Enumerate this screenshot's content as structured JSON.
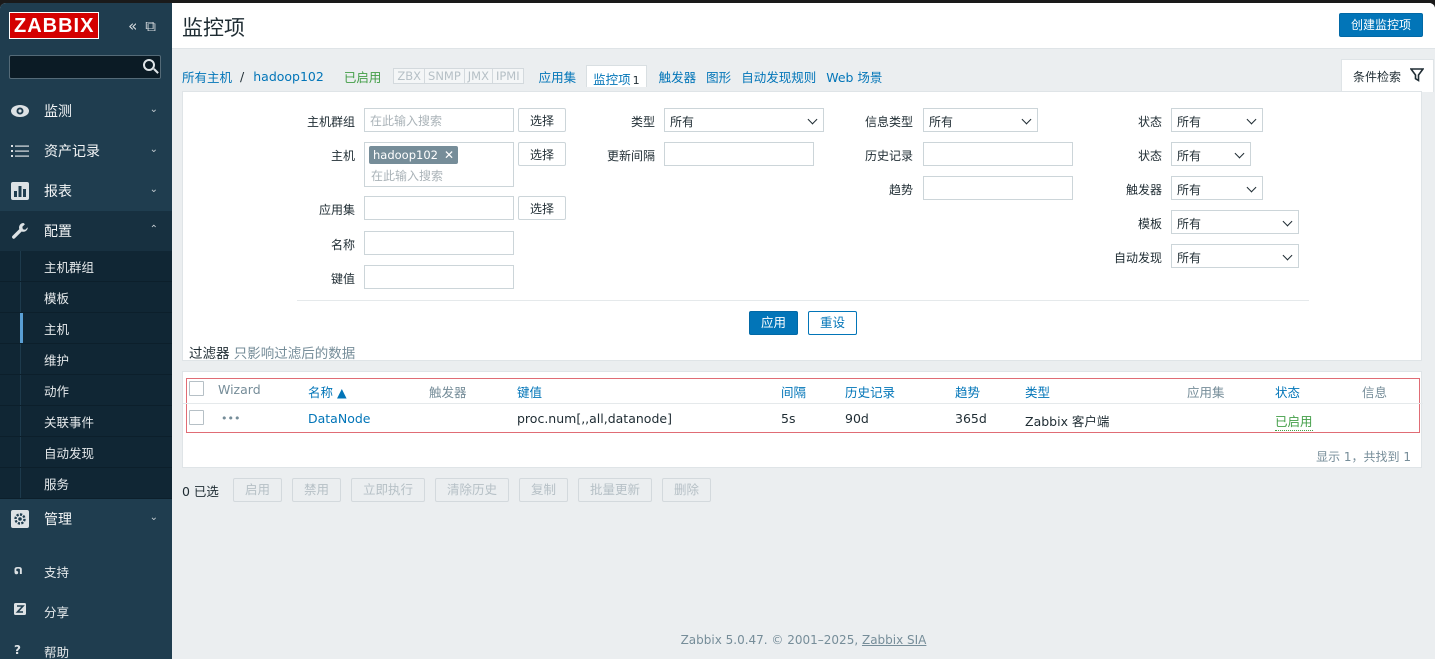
{
  "app": {
    "logo": "ZABBIX"
  },
  "sidebar": {
    "menu": [
      {
        "label": "监测",
        "icon": "eye-icon"
      },
      {
        "label": "资产记录",
        "icon": "list-icon"
      },
      {
        "label": "报表",
        "icon": "bar-chart-icon"
      },
      {
        "label": "配置",
        "icon": "wrench-icon"
      }
    ],
    "submenu": [
      "主机群组",
      "模板",
      "主机",
      "维护",
      "动作",
      "关联事件",
      "自动发现",
      "服务"
    ],
    "admin": {
      "label": "管理",
      "icon": "gear-icon"
    },
    "bottom": [
      {
        "label": "支持",
        "icon": "headset-icon"
      },
      {
        "label": "分享",
        "icon": "share-icon"
      },
      {
        "label": "帮助",
        "icon": "question-icon"
      }
    ]
  },
  "header": {
    "title": "监控项",
    "create_button": "创建监控项"
  },
  "nav": {
    "all_hosts": "所有主机",
    "separator": "/",
    "host": "hadoop102",
    "status": "已启用",
    "protocols": [
      "ZBX",
      "SNMP",
      "JMX",
      "IPMI"
    ],
    "applications": "应用集",
    "items": "监控项",
    "items_count": "1",
    "triggers": "触发器",
    "graphs": "图形",
    "discovery": "自动发现规则",
    "web": "Web 场景"
  },
  "filter": {
    "tab_label": "条件检索",
    "host_group_label": "主机群组",
    "host_group_placeholder": "在此输入搜索",
    "select_button": "选择",
    "host_label": "主机",
    "host_chip": "hadoop102",
    "host_placeholder": "在此输入搜索",
    "app_label": "应用集",
    "name_label": "名称",
    "key_label": "键值",
    "type_label": "类型",
    "type_value": "所有",
    "interval_label": "更新间隔",
    "info_type_label": "信息类型",
    "info_type_value": "所有",
    "history_label": "历史记录",
    "trends_label": "趋势",
    "state_label": "状态",
    "state_value": "所有",
    "status_label": "状态",
    "status_value": "所有",
    "triggers_label": "触发器",
    "triggers_value": "所有",
    "template_label": "模板",
    "template_value": "所有",
    "discovery_label": "自动发现",
    "discovery_value": "所有",
    "apply_button": "应用",
    "reset_button": "重设",
    "note_label": "过滤器",
    "note_text": "只影响过滤后的数据"
  },
  "table": {
    "headers": {
      "wizard": "Wizard",
      "name": "名称 ▲",
      "triggers": "触发器",
      "key": "键值",
      "interval": "间隔",
      "history": "历史记录",
      "trends": "趋势",
      "type": "类型",
      "applications": "应用集",
      "status": "状态",
      "info": "信息"
    },
    "rows": [
      {
        "wizard": "•••",
        "name": "DataNode",
        "key": "proc.num[,,all,datanode]",
        "interval": "5s",
        "history": "90d",
        "trends": "365d",
        "type": "Zabbix 客户端",
        "status": "已启用"
      }
    ],
    "paging": "显示 1，共找到 1"
  },
  "actions": {
    "selected": "0 已选",
    "buttons": [
      "启用",
      "禁用",
      "立即执行",
      "清除历史",
      "复制",
      "批量更新",
      "删除"
    ]
  },
  "footer": {
    "text": "Zabbix 5.0.47. © 2001–2025,",
    "link": "Zabbix SIA"
  }
}
